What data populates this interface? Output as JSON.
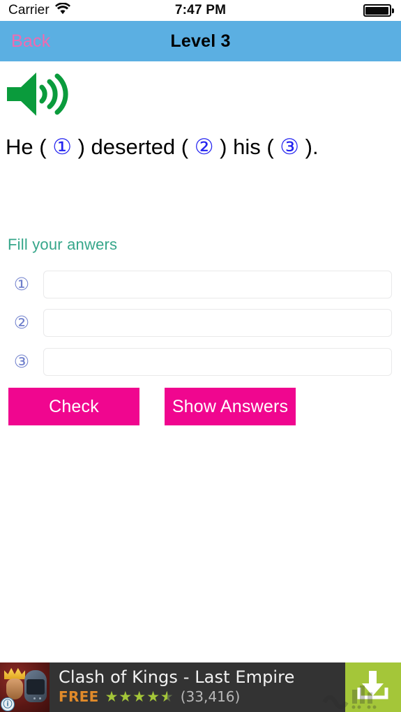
{
  "status_bar": {
    "carrier": "Carrier",
    "wifi_icon": "wifi-icon",
    "time": "7:47 PM",
    "battery_icon": "battery-full-icon"
  },
  "nav_bar": {
    "back_label": "Back",
    "title": "Level 3",
    "background_color": "#5bafe2",
    "back_color": "#f06ab0"
  },
  "main": {
    "speaker_icon": "speaker-volume-icon",
    "speaker_color": "#0a9b3c",
    "sentence": {
      "part_1": "He ( ",
      "blank_1": "①",
      "part_2": " ) deserted ( ",
      "blank_2": "②",
      "part_3": " ) his ( ",
      "blank_3": "③",
      "part_4": " ).",
      "blank_color": "#2323f0"
    },
    "fill_label": "Fill your anwers",
    "fill_label_color": "#36a68a",
    "answers": [
      {
        "number": "①",
        "value": "",
        "placeholder": ""
      },
      {
        "number": "②",
        "value": "",
        "placeholder": ""
      },
      {
        "number": "③",
        "value": "",
        "placeholder": ""
      }
    ],
    "buttons": {
      "check_label": "Check",
      "show_answers_label": "Show Answers",
      "color": "#f0068f"
    }
  },
  "ad": {
    "app_icon": "clash-of-kings-app-icon",
    "info_badge": "ⓘ",
    "title": "Clash of Kings - Last Empire",
    "price": "FREE",
    "price_color": "#e08a2a",
    "rating": 4.5,
    "stars_full": 4,
    "stars_half": 1,
    "star_color": "#a4c639",
    "review_count": "(33,416)",
    "cta_icon": "download-arrow-icon",
    "cta_background": "#a4c639",
    "background_color": "#333333"
  }
}
